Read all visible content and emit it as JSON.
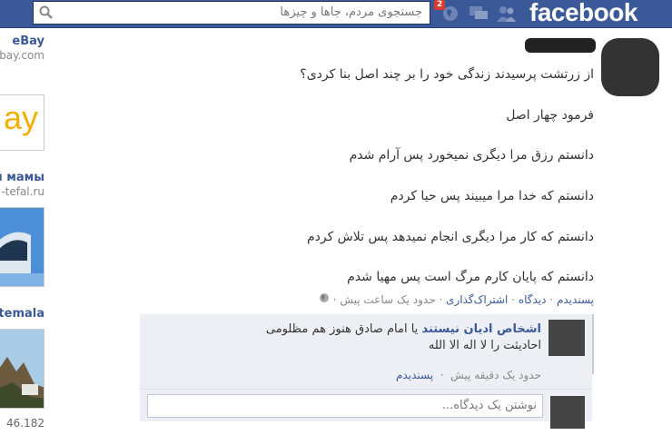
{
  "header": {
    "logo": "facebook",
    "search_placeholder": "جستجوی مردم، جاها و چیزها",
    "notification_count": "2",
    "brand_color": "#3b5998"
  },
  "sidebar": {
    "ads": [
      {
        "title": "eBay",
        "url": "bay.com"
      },
      {
        "title": "й мамы",
        "url": "-tefal.ru"
      },
      {
        "title": "temala",
        "url": ""
      }
    ],
    "ebay_logo": "ay",
    "likes_count": "46.182"
  },
  "post": {
    "lines": [
      "از زرتشت پرسیدند زندگی خود را بر چند اصل بنا کردی؟",
      "فرمود چهار اصل",
      "دانستم رزق مرا دیگری نمیخورد پس آرام شدم",
      "دانستم که خدا مرا میبیند پس حیا کردم",
      "دانستم که کار مرا دیگری انجام نمیدهد پس تلاش کردم",
      "دانستم که پایان کارم مرگ است پس مهیا شدم"
    ],
    "actions": {
      "like": "پسندیدم",
      "comment": "دیدگاه",
      "share": "اشتراک‌گذاری",
      "time": "حدود یک ساعت پیش",
      "separator": "·"
    }
  },
  "comment": {
    "author": "اشخاص ادیان نیستند",
    "text_line1": "یا امام صادق هنوز هم مظلومی",
    "text_line2": "احادیثت را لا اله الا الله",
    "time": "حدود یک دقیقه پیش",
    "like": "پسندیدم"
  },
  "comment_input": {
    "placeholder": "نوشتن یک دیدگاه..."
  }
}
